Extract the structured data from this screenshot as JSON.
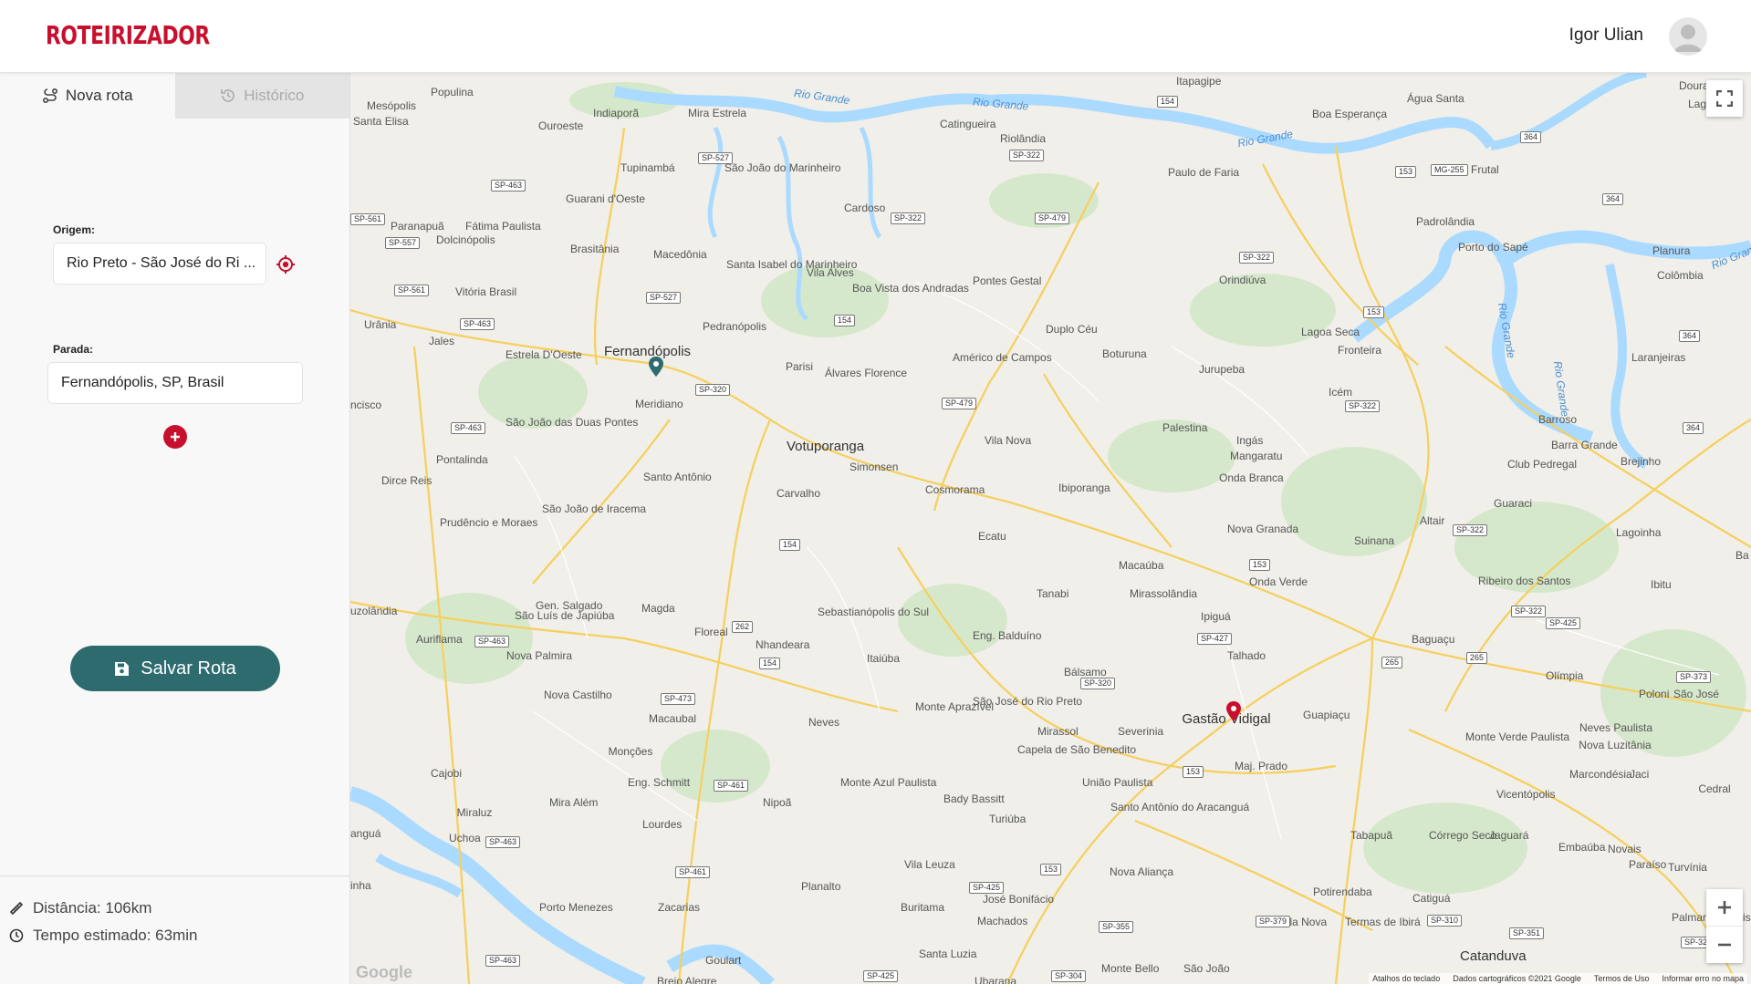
{
  "header": {
    "logo_text": "ROTEIRIZADOR",
    "user_name": "Igor Ulian"
  },
  "tabs": [
    {
      "label": "Nova rota",
      "icon": "route-icon",
      "active": true
    },
    {
      "label": "Histórico",
      "icon": "history-icon",
      "active": false
    }
  ],
  "form": {
    "origin_label": "Origem:",
    "origin_value": "Rio Preto - São José do Ri ...",
    "stop_label": "Parada:",
    "stop_value": "Fernandópolis, SP, Brasil"
  },
  "save_button": {
    "label": "Salvar Rota",
    "icon": "save-icon"
  },
  "stats": {
    "distance": "Distância: 106km",
    "time": "Tempo estimado: 63min"
  },
  "map": {
    "labels": [
      {
        "text": "Populina"
      },
      {
        "text": "Mesópolis"
      },
      {
        "text": "Santa Elisa"
      },
      {
        "text": "Indiaporã"
      },
      {
        "text": "Ouroeste"
      },
      {
        "text": "Mira Estrela"
      },
      {
        "text": "Tupinambá"
      },
      {
        "text": "São João do Marinheiro"
      },
      {
        "text": "Catingueira"
      },
      {
        "text": "Riolândia"
      },
      {
        "text": "Itapagipe"
      },
      {
        "text": "Água Santa"
      },
      {
        "text": "Boa Esperança"
      },
      {
        "text": "Paulo de Faria"
      },
      {
        "text": "Frutal"
      },
      {
        "text": "Dourados"
      },
      {
        "text": "Lagoa"
      },
      {
        "text": "Guarani d'Oeste"
      },
      {
        "text": "Cardoso"
      },
      {
        "text": "Paranapuã"
      },
      {
        "text": "Fátima Paulista"
      },
      {
        "text": "Dolcinópolis"
      },
      {
        "text": "Brasitânia"
      },
      {
        "text": "Macedônia"
      },
      {
        "text": "Santa Isabel do Marinheiro"
      },
      {
        "text": "Vila Alves"
      },
      {
        "text": "Boa Vista dos Andradas"
      },
      {
        "text": "Pontes Gestal"
      },
      {
        "text": "Orindiúva"
      },
      {
        "text": "Padrolândia"
      },
      {
        "text": "Porto do Sapé"
      },
      {
        "text": "Planura"
      },
      {
        "text": "Colômbia"
      },
      {
        "text": "Vitória Brasil"
      },
      {
        "text": "Urânia"
      },
      {
        "text": "Jales"
      },
      {
        "text": "Estrela D'Oeste"
      },
      {
        "text": "Fernandópolis"
      },
      {
        "text": "Pedranópolis"
      },
      {
        "text": "Duplo Céu"
      },
      {
        "text": "Lagoa Seca"
      },
      {
        "text": "Fronteira"
      },
      {
        "text": "Laranjeiras"
      },
      {
        "text": "Parisi"
      },
      {
        "text": "Álvares Florence"
      },
      {
        "text": "Américo de Campos"
      },
      {
        "text": "Boturuna"
      },
      {
        "text": "Jurupeba"
      },
      {
        "text": "Icém"
      },
      {
        "text": "Meridiano"
      },
      {
        "text": "Votuporanga"
      },
      {
        "text": "São João das Duas Pontes"
      },
      {
        "text": "Vila Nova"
      },
      {
        "text": "Palestina"
      },
      {
        "text": "Barroso"
      },
      {
        "text": "Barra Grande"
      },
      {
        "text": "Club Pedregal"
      },
      {
        "text": "Brejinho"
      },
      {
        "text": "Pontalinda"
      },
      {
        "text": "Simonsen"
      },
      {
        "text": "Ingás"
      },
      {
        "text": "Mangaratu"
      },
      {
        "text": "Dirce Reis"
      },
      {
        "text": "Santo Antônio"
      },
      {
        "text": "Cosmorama"
      },
      {
        "text": "Ibiporanga"
      },
      {
        "text": "Onda Branca"
      },
      {
        "text": "Carvalho"
      },
      {
        "text": "Guaraci"
      },
      {
        "text": "São João de Iracema"
      },
      {
        "text": "Prudêncio e Moraes"
      },
      {
        "text": "Altair"
      },
      {
        "text": "Nova Granada"
      },
      {
        "text": "Suinana"
      },
      {
        "text": "Lagoinha"
      },
      {
        "text": "Ecatu"
      },
      {
        "text": "Macaúba"
      },
      {
        "text": "Onda Verde"
      },
      {
        "text": "Ribeiro dos Santos"
      },
      {
        "text": "Ibitu"
      },
      {
        "text": "Mirassolândia"
      },
      {
        "text": "Tanabi"
      },
      {
        "text": "Gen. Salgado"
      },
      {
        "text": "Magda"
      },
      {
        "text": "São Luís de Japiúba"
      },
      {
        "text": "Sebastianópolis do Sul"
      },
      {
        "text": "Floreal"
      },
      {
        "text": "Ipiguá"
      },
      {
        "text": "Auriflama"
      },
      {
        "text": "Eng. Balduíno"
      },
      {
        "text": "Baguaçu"
      },
      {
        "text": "Nhandeara"
      },
      {
        "text": "Talhado"
      },
      {
        "text": "Nova Palmira"
      },
      {
        "text": "Itaiúba"
      },
      {
        "text": "Bálsamo"
      },
      {
        "text": "Olímpia"
      },
      {
        "text": "Nova Castilho"
      },
      {
        "text": "Guapiaçu"
      },
      {
        "text": "São José"
      },
      {
        "text": "Poloni"
      },
      {
        "text": "Monte Aprazível"
      },
      {
        "text": "São José do Rio Preto"
      },
      {
        "text": "Gastão Vidigal"
      },
      {
        "text": "Macaubal"
      },
      {
        "text": "Neves"
      },
      {
        "text": "Mirassol"
      },
      {
        "text": "Severinia"
      },
      {
        "text": "Neves Paulista"
      },
      {
        "text": "Capela de São Benedito"
      },
      {
        "text": "Monte Verde Paulista"
      },
      {
        "text": "Nova Luzitânia"
      },
      {
        "text": "Monções"
      },
      {
        "text": "Eng. Schmitt"
      },
      {
        "text": "Maj. Prado"
      },
      {
        "text": "Cajobi"
      },
      {
        "text": "Marcondésia"
      },
      {
        "text": "Jaci"
      },
      {
        "text": "União Paulista"
      },
      {
        "text": "Monte Azul Paulista"
      },
      {
        "text": "Cedral"
      },
      {
        "text": "Vicentópolis"
      },
      {
        "text": "Mira Além"
      },
      {
        "text": "Nipoã"
      },
      {
        "text": "Bady Bassitt"
      },
      {
        "text": "Santo Antônio do Aracanguá"
      },
      {
        "text": "Miraluz"
      },
      {
        "text": "Turiúba"
      },
      {
        "text": "Lourdes"
      },
      {
        "text": "Uchoa"
      },
      {
        "text": "Tabapuã"
      },
      {
        "text": "Córrego Seco"
      },
      {
        "text": "Jaguará"
      },
      {
        "text": "Embaúba"
      },
      {
        "text": "Novais"
      },
      {
        "text": "Vila Leuza"
      },
      {
        "text": "Paraíso"
      },
      {
        "text": "Turvínia"
      },
      {
        "text": "Nova Aliança"
      },
      {
        "text": "Planalto"
      },
      {
        "text": "José Bonifácio"
      },
      {
        "text": "Potirendaba"
      },
      {
        "text": "Catiguá"
      },
      {
        "text": "Porto Menezes"
      },
      {
        "text": "Zacarias"
      },
      {
        "text": "Buritama"
      },
      {
        "text": "Machados"
      },
      {
        "text": "Vila Nova"
      },
      {
        "text": "Termas de Ibirá"
      },
      {
        "text": "Palmares Paulista"
      },
      {
        "text": "Santa Luzia"
      },
      {
        "text": "Goulart"
      },
      {
        "text": "Monte Bello"
      },
      {
        "text": "São João"
      },
      {
        "text": "Catanduva"
      },
      {
        "text": "Ubarana"
      },
      {
        "text": "Brejo Alegre"
      },
      {
        "text": "Rio Grande"
      },
      {
        "text": "Rio Grande"
      },
      {
        "text": "Rio Grande"
      },
      {
        "text": "Rio Grande"
      },
      {
        "text": "Rio Grande"
      },
      {
        "text": "Rio Grande"
      },
      {
        "text": "ncisco"
      },
      {
        "text": "uzolândia"
      },
      {
        "text": "anguá"
      },
      {
        "text": "inha"
      },
      {
        "text": "Ba"
      }
    ],
    "shields": [
      "154",
      "MG-255",
      "153",
      "364",
      "364",
      "SP-527",
      "SP-322",
      "SP-463",
      "SP-561",
      "SP-557",
      "SP-322",
      "SP-479",
      "SP-322",
      "SP-561",
      "SP-527",
      "154",
      "153",
      "364",
      "SP-463",
      "SP-320",
      "SP-479",
      "SP-322",
      "SP-463",
      "364",
      "154",
      "SP-322",
      "153",
      "SP-322",
      "SP-427",
      "SP-425",
      "262",
      "SP-463",
      "154",
      "265",
      "SP-473",
      "SP-320",
      "265",
      "SP-373",
      "153",
      "SP-461",
      "SP-463",
      "SP-461",
      "153",
      "SP-425",
      "SP-355",
      "SP-379",
      "SP-310",
      "SP-351",
      "SP-463",
      "SP-425",
      "SP-304",
      "SP-32"
    ],
    "attribution": {
      "shortcuts": "Atalhos do teclado",
      "data": "Dados cartográficos ©2021 Google",
      "terms": "Termos de Uso",
      "report": "Informar erro no mapa"
    },
    "google_logo": "Google"
  }
}
